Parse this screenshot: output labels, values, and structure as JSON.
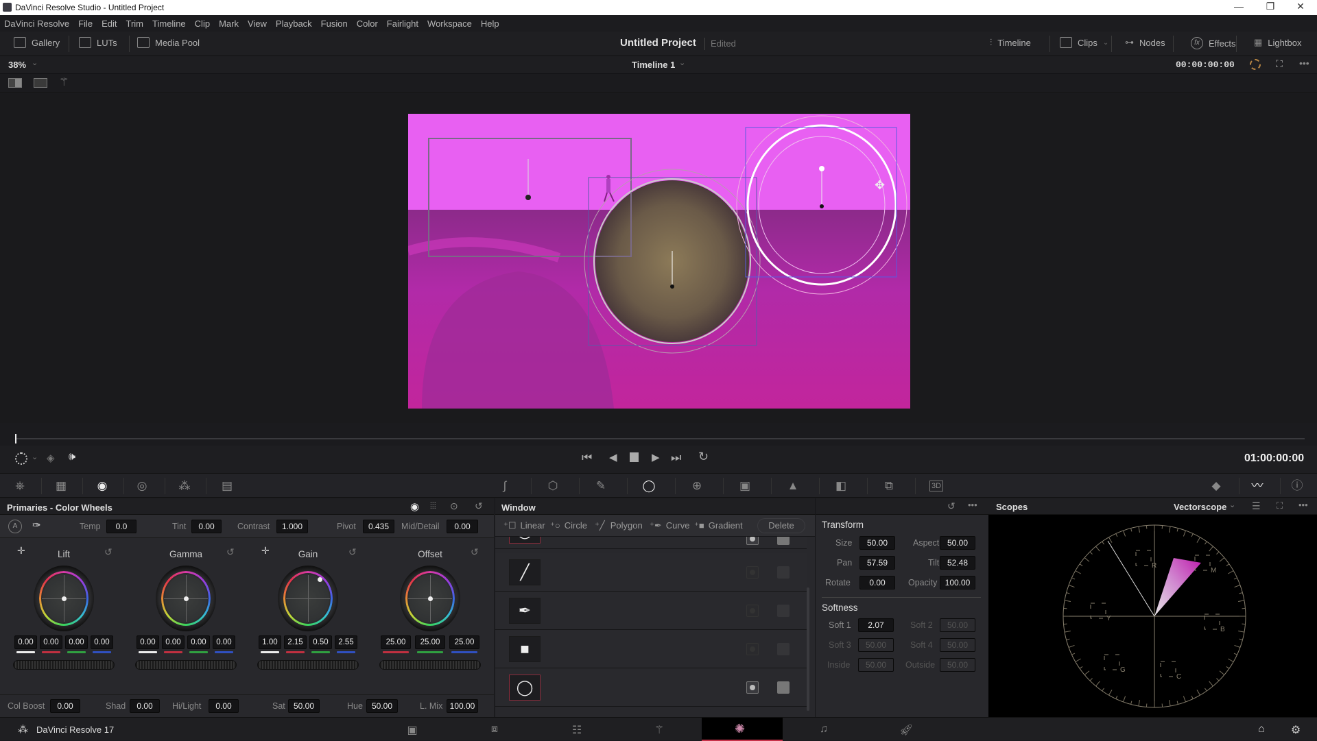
{
  "window": {
    "title": "DaVinci Resolve Studio - Untitled Project",
    "controls": {
      "minimize": "—",
      "maximize": "❐",
      "close": "✕"
    }
  },
  "menu": [
    "DaVinci Resolve",
    "File",
    "Edit",
    "Trim",
    "Timeline",
    "Clip",
    "Mark",
    "View",
    "Playback",
    "Fusion",
    "Color",
    "Fairlight",
    "Workspace",
    "Help"
  ],
  "toolbar": {
    "left": [
      {
        "label": "Gallery",
        "icon": "gallery-icon"
      },
      {
        "label": "LUTs",
        "icon": "luts-icon"
      },
      {
        "label": "Media Pool",
        "icon": "media-pool-icon"
      }
    ],
    "project_title": "Untitled Project",
    "project_status": "Edited",
    "right": [
      {
        "label": "Timeline",
        "icon": "timeline-icon"
      },
      {
        "label": "Clips",
        "icon": "clips-icon"
      },
      {
        "label": "Nodes",
        "icon": "nodes-icon"
      },
      {
        "label": "Effects",
        "icon": "fx-icon"
      },
      {
        "label": "Lightbox",
        "icon": "lightbox-icon"
      }
    ]
  },
  "viewer": {
    "zoom": "38%",
    "timeline_name": "Timeline 1",
    "source_timecode": "00:00:00:00",
    "record_timecode": "01:00:00:00"
  },
  "primaries": {
    "title": "Primaries - Color Wheels",
    "params": {
      "temp": {
        "label": "Temp",
        "value": "0.0"
      },
      "tint": {
        "label": "Tint",
        "value": "0.00"
      },
      "contrast": {
        "label": "Contrast",
        "value": "1.000"
      },
      "pivot": {
        "label": "Pivot",
        "value": "0.435"
      },
      "mid_detail": {
        "label": "Mid/Detail",
        "value": "0.00"
      }
    },
    "wheels": [
      {
        "name": "Lift",
        "values": [
          "0.00",
          "0.00",
          "0.00",
          "0.00"
        ]
      },
      {
        "name": "Gamma",
        "values": [
          "0.00",
          "0.00",
          "0.00",
          "0.00"
        ]
      },
      {
        "name": "Gain",
        "values": [
          "1.00",
          "2.15",
          "0.50",
          "2.55"
        ]
      },
      {
        "name": "Offset",
        "values": [
          "25.00",
          "25.00",
          "25.00"
        ]
      }
    ],
    "bottom": {
      "col_boost": {
        "label": "Col Boost",
        "value": "0.00"
      },
      "shad": {
        "label": "Shad",
        "value": "0.00"
      },
      "hi_light": {
        "label": "Hi/Light",
        "value": "0.00"
      },
      "sat": {
        "label": "Sat",
        "value": "50.00"
      },
      "hue": {
        "label": "Hue",
        "value": "50.00"
      },
      "l_mix": {
        "label": "L. Mix",
        "value": "100.00"
      }
    }
  },
  "window_panel": {
    "title": "Window",
    "tools": [
      "Linear",
      "Circle",
      "Polygon",
      "Curve",
      "Gradient"
    ],
    "delete_label": "Delete",
    "rows": [
      {
        "shape": "circle",
        "glyph": "◯",
        "selected": true,
        "enabled": true
      },
      {
        "shape": "linear",
        "glyph": "╱",
        "selected": false,
        "enabled": false
      },
      {
        "shape": "curve",
        "glyph": "✒",
        "selected": false,
        "enabled": false
      },
      {
        "shape": "gradient",
        "glyph": "■",
        "selected": false,
        "enabled": false
      },
      {
        "shape": "circle",
        "glyph": "◯",
        "selected": true,
        "enabled": true
      }
    ]
  },
  "transform": {
    "title": "Transform",
    "size": {
      "label": "Size",
      "value": "50.00"
    },
    "aspect": {
      "label": "Aspect",
      "value": "50.00"
    },
    "pan": {
      "label": "Pan",
      "value": "57.59"
    },
    "tilt": {
      "label": "Tilt",
      "value": "52.48"
    },
    "rotate": {
      "label": "Rotate",
      "value": "0.00"
    },
    "opacity": {
      "label": "Opacity",
      "value": "100.00"
    }
  },
  "softness": {
    "title": "Softness",
    "soft1": {
      "label": "Soft 1",
      "value": "2.07"
    },
    "soft2": {
      "label": "Soft 2",
      "value": "50.00"
    },
    "soft3": {
      "label": "Soft 3",
      "value": "50.00"
    },
    "soft4": {
      "label": "Soft 4",
      "value": "50.00"
    },
    "inside": {
      "label": "Inside",
      "value": "50.00"
    },
    "outside": {
      "label": "Outside",
      "value": "50.00"
    }
  },
  "scopes": {
    "title": "Scopes",
    "mode": "Vectorscope",
    "targets": [
      "R",
      "M",
      "B",
      "C",
      "G",
      "Y"
    ]
  },
  "status": {
    "app_name": "DaVinci Resolve 17",
    "pages": [
      "media",
      "cut",
      "edit",
      "fusion",
      "color",
      "fairlight",
      "deliver"
    ],
    "active_page": "color"
  },
  "colors": {
    "accent_red": "#c8324a",
    "frame_magenta": "#e35cf0",
    "panel_bg": "#28282c"
  }
}
